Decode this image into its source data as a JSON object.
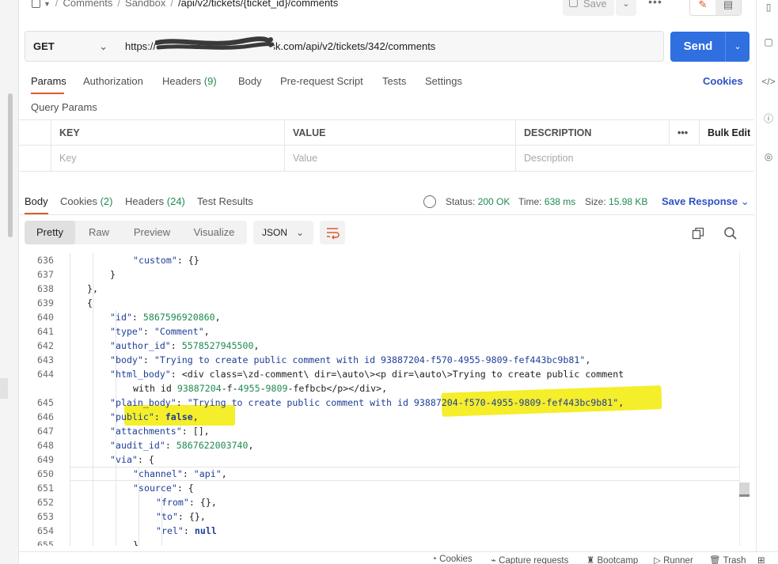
{
  "breadcrumb": {
    "items": [
      "Comments",
      "Sandbox"
    ],
    "current": "/api/v2/tickets/{ticket_id}/comments"
  },
  "toolbar": {
    "save_label": "Save",
    "more_label": "•••"
  },
  "request": {
    "method": "GET",
    "url": "https://xxxxxxxxxxxxxx00.zendesk.com/api/v2/tickets/342/comments",
    "url_visible_prefix": "https://",
    "url_visible_suffix": "00.zendesk.com/api/v2/tickets/342/comments",
    "send_label": "Send"
  },
  "request_tabs": {
    "params": "Params",
    "authorization": "Authorization",
    "headers": "Headers",
    "headers_count": "(9)",
    "body": "Body",
    "prerequest": "Pre-request Script",
    "tests": "Tests",
    "settings": "Settings",
    "cookies": "Cookies"
  },
  "query_params": {
    "title": "Query Params",
    "columns": [
      "KEY",
      "VALUE",
      "DESCRIPTION"
    ],
    "more": "•••",
    "bulk_edit": "Bulk Edit",
    "placeholders": [
      "Key",
      "Value",
      "Description"
    ]
  },
  "response_tabs": {
    "body": "Body",
    "cookies": "Cookies",
    "cookies_count": "(2)",
    "headers": "Headers",
    "headers_count": "(24)",
    "test_results": "Test Results"
  },
  "response_meta": {
    "status_label": "Status:",
    "status_value": "200 OK",
    "time_label": "Time:",
    "time_value": "638 ms",
    "size_label": "Size:",
    "size_value": "15.98 KB",
    "save_response": "Save Response"
  },
  "view": {
    "tabs": [
      "Pretty",
      "Raw",
      "Preview",
      "Visualize"
    ],
    "active": "Pretty",
    "format": "JSON"
  },
  "code_lines": [
    {
      "n": "636",
      "t": "\"custom\": {}"
    },
    {
      "n": "637",
      "t": "}"
    },
    {
      "n": "638",
      "t": "},"
    },
    {
      "n": "639",
      "t": "{"
    },
    {
      "n": "640",
      "t": "\"id\": 5867596920860,"
    },
    {
      "n": "641",
      "t": "\"type\": \"Comment\","
    },
    {
      "n": "642",
      "t": "\"author_id\": 5578527945500,"
    },
    {
      "n": "643",
      "t": "\"body\": \"Trying to create public comment with id 93887204-f570-4955-9809-fef443bc9b81\","
    },
    {
      "n": "644",
      "t": "\"html_body\": \"<div class=\\\"zd-comment\\\" dir=\\\"auto\\\"><p dir=\\\"auto\\\">Trying to create public comment"
    },
    {
      "n": "",
      "t": "with id 93887204-f570-4955-9809-fef443bc9b81</p></div>\","
    },
    {
      "n": "645",
      "t": "\"plain_body\": \"Trying to create public comment with id 93887204-f570-4955-9809-fef443bc9b81\","
    },
    {
      "n": "646",
      "t": "\"public\": false,"
    },
    {
      "n": "647",
      "t": "\"attachments\": [],"
    },
    {
      "n": "648",
      "t": "\"audit_id\": 5867622003740,"
    },
    {
      "n": "649",
      "t": "\"via\": {"
    },
    {
      "n": "650",
      "t": "\"channel\": \"api\","
    },
    {
      "n": "651",
      "t": "\"source\": {"
    },
    {
      "n": "652",
      "t": "\"from\": {},"
    },
    {
      "n": "653",
      "t": "\"to\": {},"
    },
    {
      "n": "654",
      "t": "\"rel\": null"
    },
    {
      "n": "655",
      "t": "}"
    }
  ],
  "statusbar": {
    "cookies": "Cookies",
    "capture": "Capture requests",
    "bootcamp": "Bootcamp",
    "runner": "Runner",
    "trash": "Trash"
  },
  "colors": {
    "accent": "#e0592a",
    "send": "#2f6fe0",
    "link": "#2f52c4",
    "ok": "#1f8a50",
    "highlight": "#f5ee2a"
  }
}
